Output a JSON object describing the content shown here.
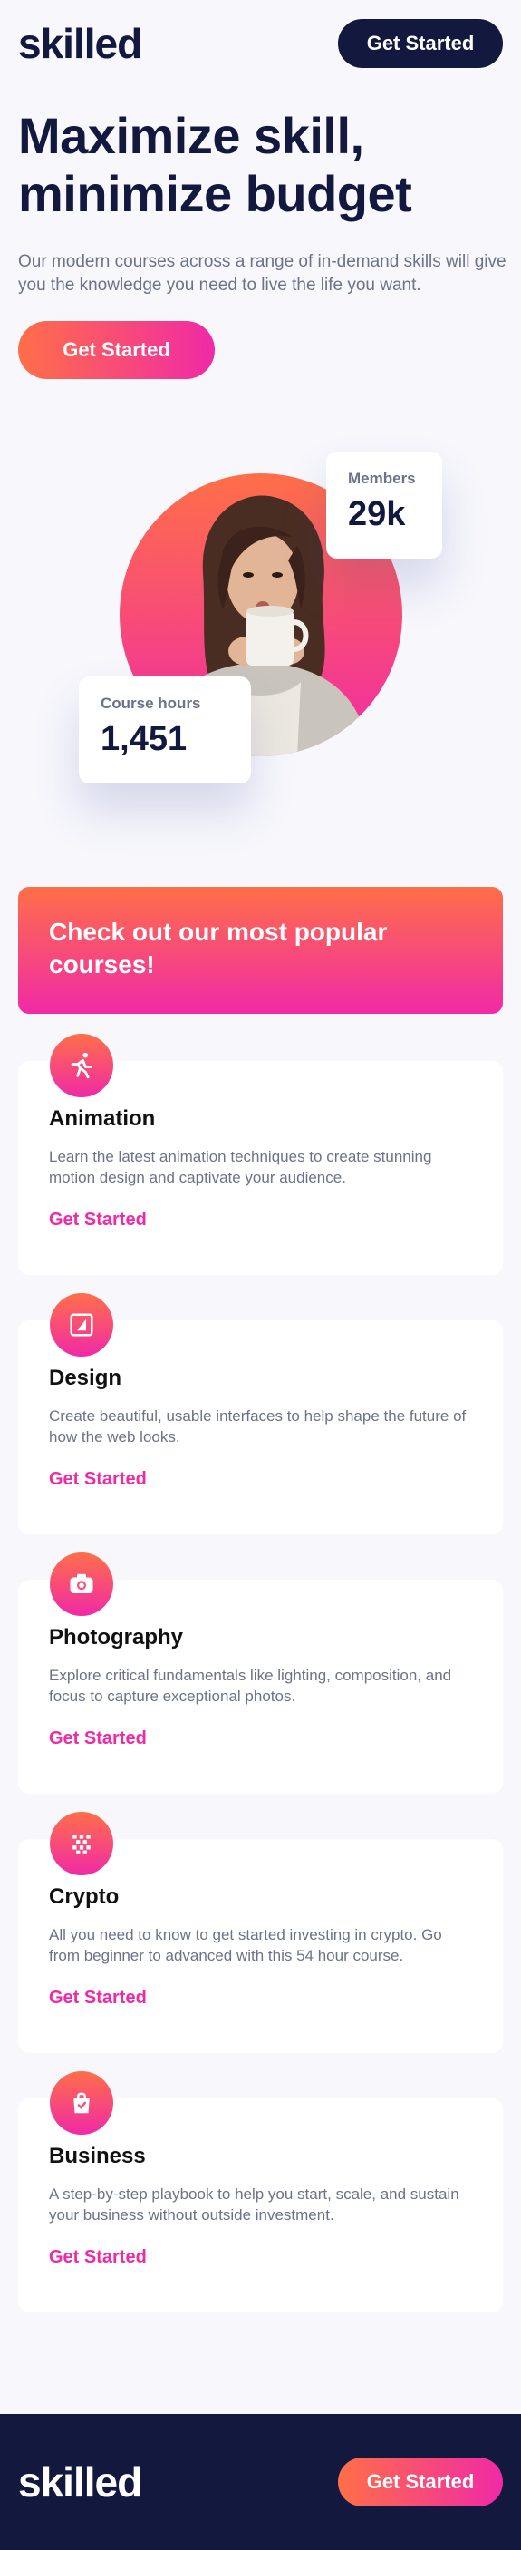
{
  "header": {
    "logo": "skilled",
    "cta_label": "Get Started"
  },
  "hero": {
    "title": "Maximize skill, minimize budget",
    "text": "Our modern courses across a range of in-demand skills will give you the knowledge you need to live the life you want.",
    "cta_label": "Get Started"
  },
  "stats": {
    "members": {
      "label": "Members",
      "value": "29k"
    },
    "hours": {
      "label": "Course hours",
      "value": "1,451"
    }
  },
  "popular": {
    "title": "Check out our most popular courses!"
  },
  "courses": [
    {
      "icon": "running-person-icon",
      "title": "Animation",
      "description": "Learn the latest animation techniques to create stunning motion design and captivate your audience.",
      "link": "Get Started"
    },
    {
      "icon": "design-frame-icon",
      "title": "Design",
      "description": "Create beautiful, usable interfaces to help shape the future of how the web looks.",
      "link": "Get Started"
    },
    {
      "icon": "camera-icon",
      "title": "Photography",
      "description": "Explore critical fundamentals like lighting, composition, and focus to capture exceptional photos.",
      "link": "Get Started"
    },
    {
      "icon": "crypto-grid-icon",
      "title": "Crypto",
      "description": "All you need to know to get started investing in crypto. Go from beginner to advanced with this 54 hour course.",
      "link": "Get Started"
    },
    {
      "icon": "shopping-bag-icon",
      "title": "Business",
      "description": "A step-by-step playbook to help you start, scale, and sustain your business without outside investment.",
      "link": "Get Started"
    }
  ],
  "footer": {
    "logo": "skilled",
    "cta_label": "Get Started"
  },
  "colors": {
    "navy": "#13183f",
    "orange": "#ff6f48",
    "pink": "#f02aa6",
    "gray_text": "#6c7289",
    "background": "#f7f7fc"
  }
}
